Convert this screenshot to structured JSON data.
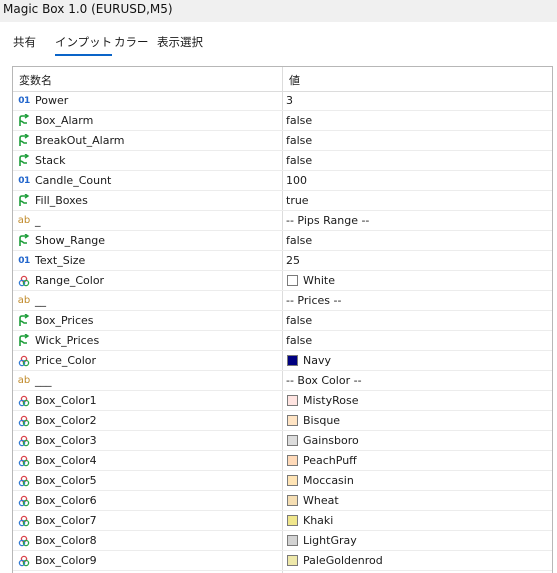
{
  "window": {
    "title": "Magic Box 1.0 (EURUSD,M5)"
  },
  "tabs": [
    {
      "label": "共有",
      "active": false
    },
    {
      "label": "インプット",
      "active": true
    },
    {
      "label": "カラー",
      "active": false
    },
    {
      "label": "表示選択",
      "active": false
    }
  ],
  "table": {
    "header": {
      "name": "変数名",
      "value": "値"
    },
    "rows": [
      {
        "type": "int",
        "name": "Power",
        "value": "3"
      },
      {
        "type": "bool",
        "name": "Box_Alarm",
        "value": "false"
      },
      {
        "type": "bool",
        "name": "BreakOut_Alarm",
        "value": "false"
      },
      {
        "type": "bool",
        "name": "Stack",
        "value": "false"
      },
      {
        "type": "int",
        "name": "Candle_Count",
        "value": "100"
      },
      {
        "type": "bool",
        "name": "Fill_Boxes",
        "value": "true"
      },
      {
        "type": "string",
        "name": "_",
        "value": "-- Pips Range --"
      },
      {
        "type": "bool",
        "name": "Show_Range",
        "value": "false"
      },
      {
        "type": "int",
        "name": "Text_Size",
        "value": "25"
      },
      {
        "type": "color",
        "name": "Range_Color",
        "value": "White",
        "color": "#ffffff"
      },
      {
        "type": "string",
        "name": "__",
        "value": "-- Prices --"
      },
      {
        "type": "bool",
        "name": "Box_Prices",
        "value": "false"
      },
      {
        "type": "bool",
        "name": "Wick_Prices",
        "value": "false"
      },
      {
        "type": "color",
        "name": "Price_Color",
        "value": "Navy",
        "color": "#000080"
      },
      {
        "type": "string",
        "name": "___",
        "value": "-- Box Color --"
      },
      {
        "type": "color",
        "name": "Box_Color1",
        "value": "MistyRose",
        "color": "#ffe4e1"
      },
      {
        "type": "color",
        "name": "Box_Color2",
        "value": "Bisque",
        "color": "#ffe4c4"
      },
      {
        "type": "color",
        "name": "Box_Color3",
        "value": "Gainsboro",
        "color": "#dcdcdc"
      },
      {
        "type": "color",
        "name": "Box_Color4",
        "value": "PeachPuff",
        "color": "#ffdab9"
      },
      {
        "type": "color",
        "name": "Box_Color5",
        "value": "Moccasin",
        "color": "#ffe4b5"
      },
      {
        "type": "color",
        "name": "Box_Color6",
        "value": "Wheat",
        "color": "#f5deb3"
      },
      {
        "type": "color",
        "name": "Box_Color7",
        "value": "Khaki",
        "color": "#f0e68c"
      },
      {
        "type": "color",
        "name": "Box_Color8",
        "value": "LightGray",
        "color": "#d3d3d3"
      },
      {
        "type": "color",
        "name": "Box_Color9",
        "value": "PaleGoldenrod",
        "color": "#eee8aa"
      }
    ]
  },
  "icons": {
    "int": "int-type-icon",
    "bool": "bool-type-icon",
    "string": "string-type-icon",
    "color": "color-type-icon"
  },
  "colors": {
    "tab_underline": "#0a64c8",
    "int_icon": "#2266cc",
    "string_icon": "#c08a2a",
    "bool_icon": "#1e9e3a"
  }
}
